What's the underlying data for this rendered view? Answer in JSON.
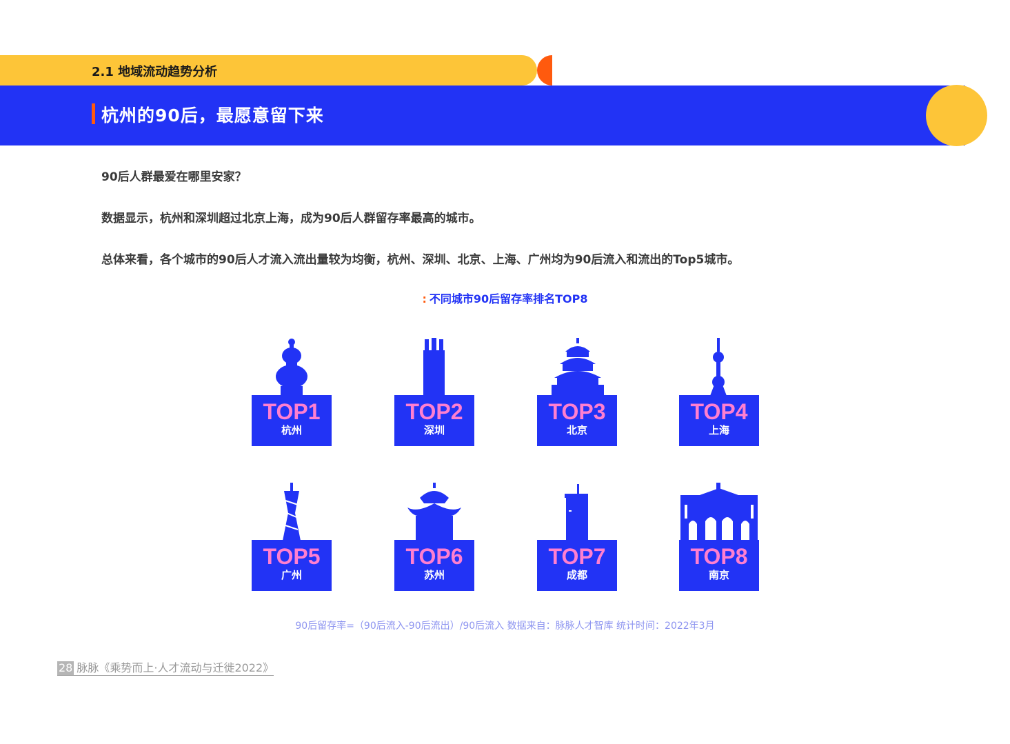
{
  "section": {
    "label": "2.1 地域流动趋势分析"
  },
  "title": "杭州的90后，最愿意留下来",
  "paragraphs": [
    "90后人群最爱在哪里安家？",
    "数据显示，杭州和深圳超过北京上海，成为90后人群留存率最高的城市。",
    "总体来看，各个城市的90后人才流入流出量较为均衡，杭州、深圳、北京、上海、广州均为90后流入和流出的Top5城市。"
  ],
  "chart_caption": {
    "colon": ":",
    "text": "不同城市90后留存率排名TOP8"
  },
  "ranking": [
    {
      "rank": "TOP1",
      "city": "杭州",
      "icon": "hangzhou-pagoda-icon"
    },
    {
      "rank": "TOP2",
      "city": "深圳",
      "icon": "shenzhen-tower-icon"
    },
    {
      "rank": "TOP3",
      "city": "北京",
      "icon": "temple-of-heaven-icon"
    },
    {
      "rank": "TOP4",
      "city": "上海",
      "icon": "oriental-pearl-tower-icon"
    },
    {
      "rank": "TOP5",
      "city": "广州",
      "icon": "canton-tower-icon"
    },
    {
      "rank": "TOP6",
      "city": "苏州",
      "icon": "suzhou-pavilion-icon"
    },
    {
      "rank": "TOP7",
      "city": "成都",
      "icon": "chengdu-tower-icon"
    },
    {
      "rank": "TOP8",
      "city": "南京",
      "icon": "nanjing-gate-icon"
    }
  ],
  "footnote": "90后留存率=（90后流入-90后流出）/90后流入   数据来自：脉脉人才智库   统计时间：2022年3月",
  "footer": {
    "page": "28",
    "text": "脉脉《乘势而上·人才流动与迁徙2022》"
  },
  "colors": {
    "blue": "#2233F5",
    "yellow": "#FDC538",
    "orange": "#FF5A0E",
    "pink": "#FF7FD0"
  }
}
